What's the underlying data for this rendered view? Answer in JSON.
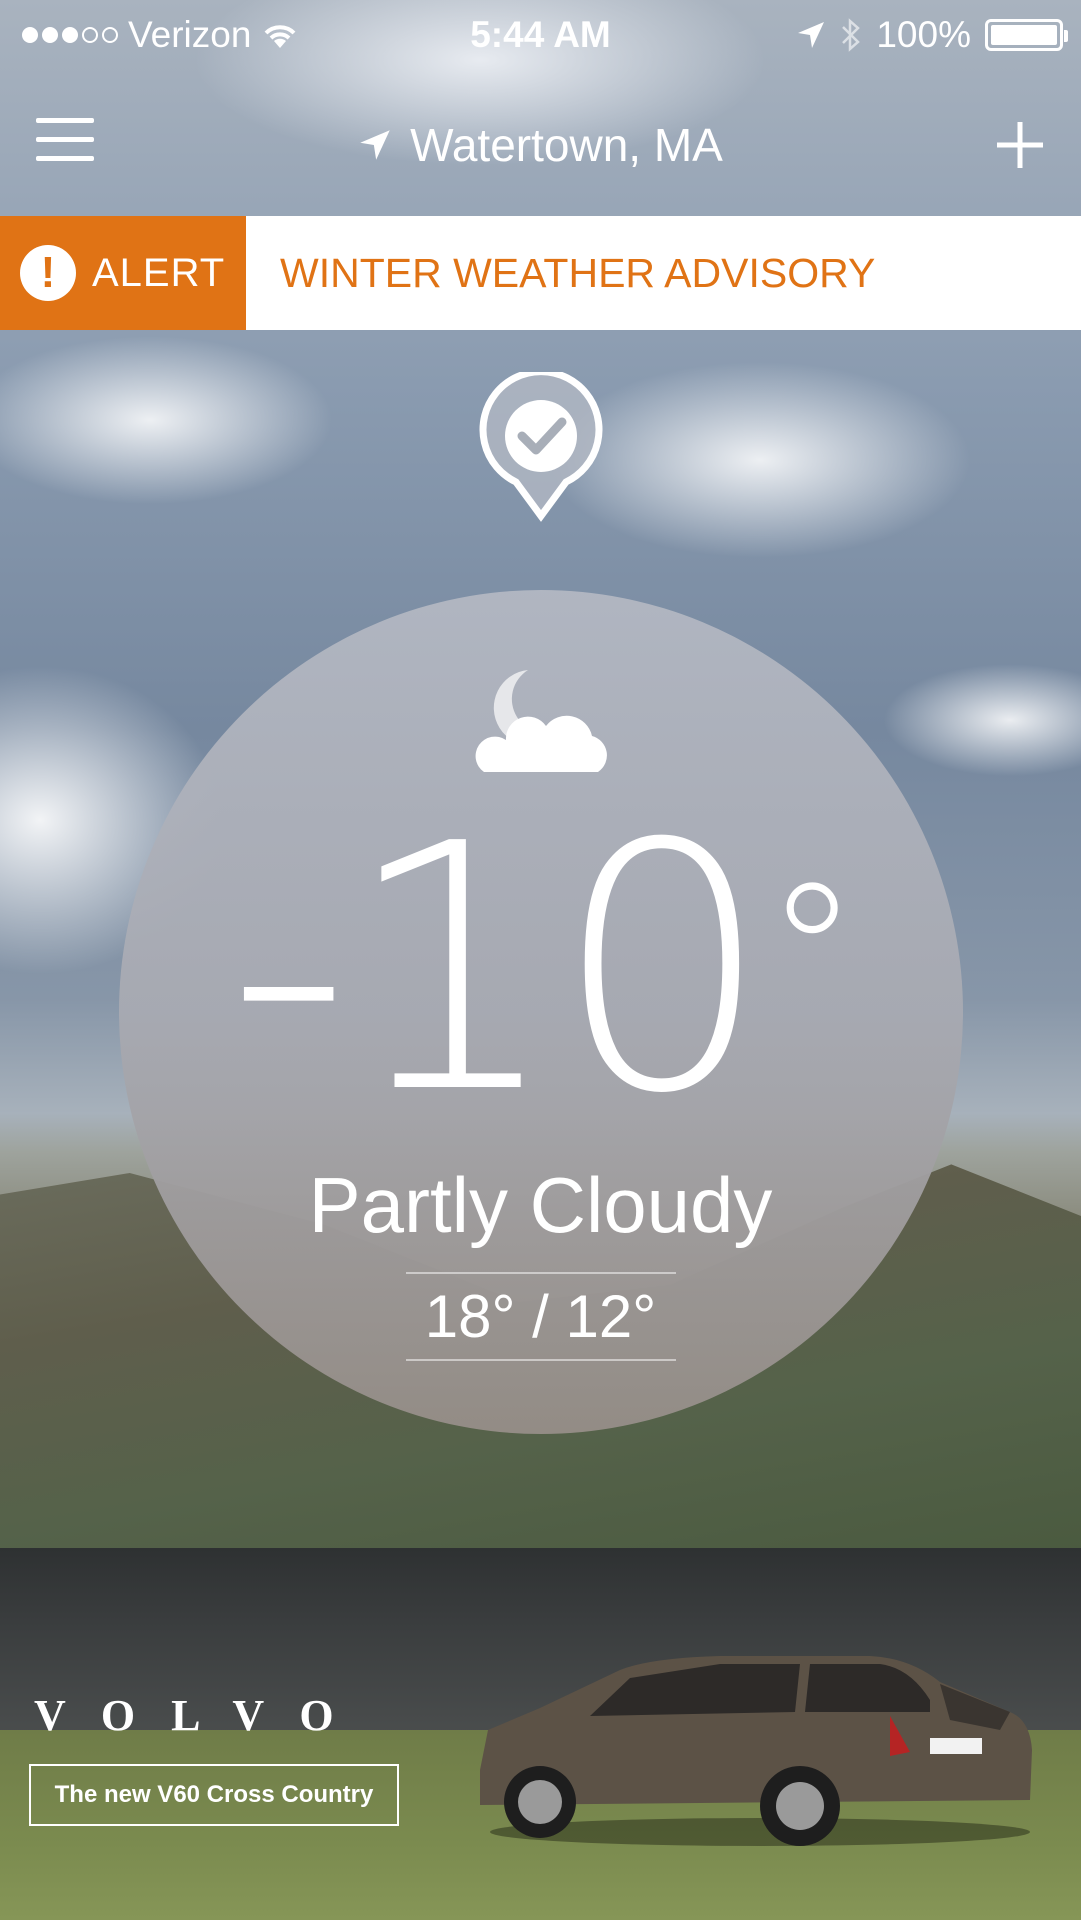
{
  "status_bar": {
    "carrier": "Verizon",
    "time": "5:44 AM",
    "battery": "100%",
    "signal_bars": 3,
    "signal_total": 5
  },
  "nav": {
    "location": "Watertown, MA"
  },
  "alert": {
    "tag": "ALERT",
    "message": "WINTER WEATHER ADVISORY",
    "color": "#e07315"
  },
  "weather": {
    "temperature": "-10",
    "unit": "°",
    "condition": "Partly Cloudy",
    "hi_lo": "18° / 12°"
  },
  "ad": {
    "brand": "VOLVO",
    "tagline": "The new V60 Cross Country"
  },
  "icons": {
    "menu": "hamburger-menu-icon",
    "location": "location-arrow-icon",
    "add": "plus-icon",
    "alert": "exclamation-icon",
    "pin": "checkmark-pin-icon",
    "condition": "moon-cloud-icon"
  }
}
